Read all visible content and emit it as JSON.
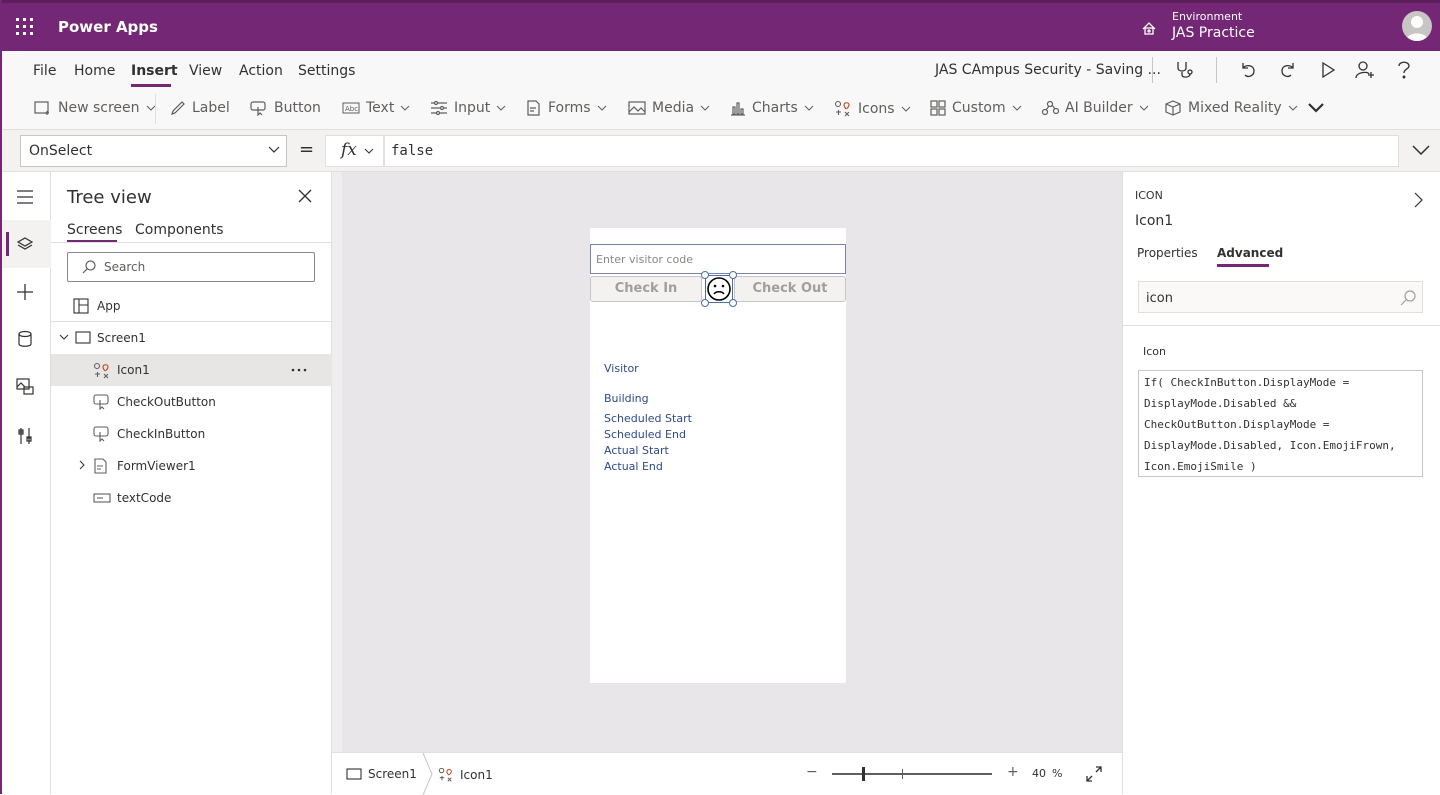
{
  "header": {
    "app_name": "Power Apps",
    "environment_label": "Environment",
    "environment_name": "JAS Practice"
  },
  "menu": {
    "items": [
      "File",
      "Home",
      "Insert",
      "View",
      "Action",
      "Settings"
    ],
    "active": "Insert",
    "doc_title": "JAS CAmpus Security - Saving ..."
  },
  "ribbon": {
    "items": [
      "New screen",
      "Label",
      "Button",
      "Text",
      "Input",
      "Forms",
      "Media",
      "Charts",
      "Icons",
      "Custom",
      "AI Builder",
      "Mixed Reality"
    ]
  },
  "formula_bar": {
    "property": "OnSelect",
    "equals": "=",
    "fx": "fx",
    "formula": "false"
  },
  "tree_view": {
    "title": "Tree view",
    "tabs": [
      "Screens",
      "Components"
    ],
    "search_placeholder": "Search",
    "app_label": "App",
    "items": [
      {
        "label": "Screen1"
      },
      {
        "label": "Icon1"
      },
      {
        "label": "CheckOutButton"
      },
      {
        "label": "CheckInButton"
      },
      {
        "label": "FormViewer1"
      },
      {
        "label": "textCode"
      }
    ]
  },
  "canvas": {
    "visitor_placeholder": "Enter visitor code",
    "check_in": "Check In",
    "check_out": "Check Out",
    "form_labels": [
      "Visitor",
      "Building",
      "Scheduled Start",
      "Scheduled End",
      "Actual Start",
      "Actual End"
    ]
  },
  "status_bar": {
    "screen": "Screen1",
    "control": "Icon1",
    "zoom_minus": "−",
    "zoom_plus": "+",
    "zoom_value": "40",
    "zoom_unit": "%"
  },
  "right_panel": {
    "type": "ICON",
    "name": "Icon1",
    "tabs": [
      "Properties",
      "Advanced"
    ],
    "active_tab": "Advanced",
    "search_value": "icon",
    "property_name": "Icon",
    "property_code": "If( CheckInButton.DisplayMode =\nDisplayMode.Disabled &&\nCheckOutButton.DisplayMode =\nDisplayMode.Disabled, Icon.EmojiFrown,\nIcon.EmojiSmile )"
  },
  "colors": {
    "brand": "#742774",
    "selection": "#4a6ea8",
    "form_label": "#2f4a8a"
  }
}
